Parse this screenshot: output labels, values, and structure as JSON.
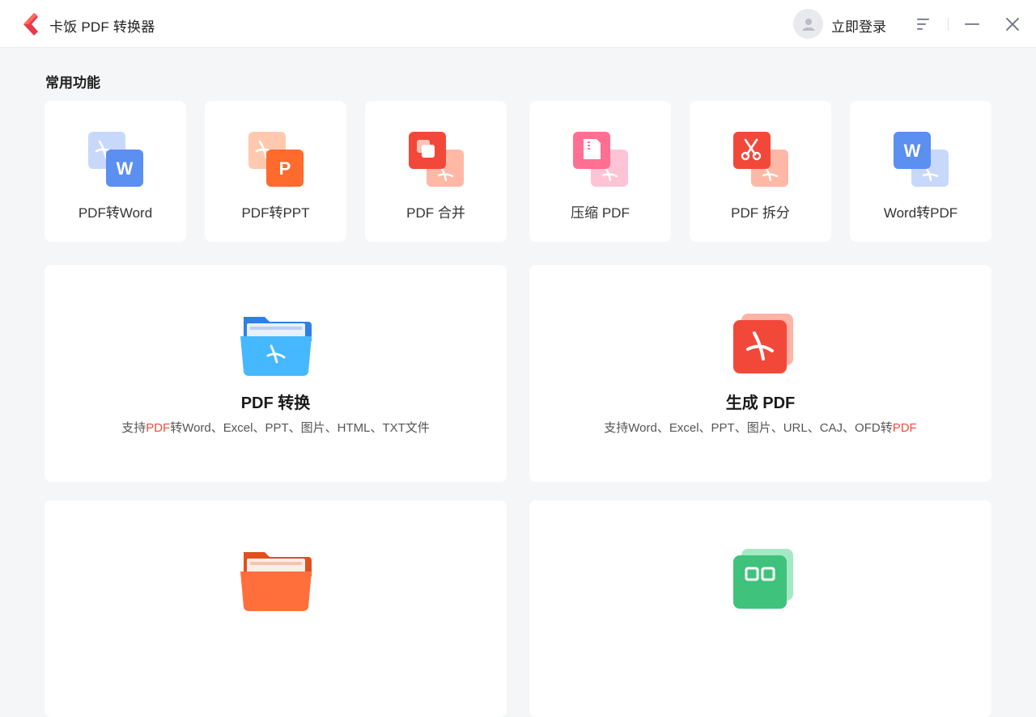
{
  "app": {
    "title": "卡饭 PDF 转换器",
    "login_label": "立即登录"
  },
  "section": {
    "common_title": "常用功能"
  },
  "tools": [
    {
      "label": "PDF转Word",
      "icon": "pdf-to-word-icon"
    },
    {
      "label": "PDF转PPT",
      "icon": "pdf-to-ppt-icon"
    },
    {
      "label": "PDF 合并",
      "icon": "pdf-merge-icon"
    },
    {
      "label": "压缩 PDF",
      "icon": "pdf-compress-icon"
    },
    {
      "label": "PDF 拆分",
      "icon": "pdf-split-icon"
    },
    {
      "label": "Word转PDF",
      "icon": "word-to-pdf-icon"
    }
  ],
  "features": [
    {
      "title": "PDF 转换",
      "desc_prefix": "支持",
      "desc_highlight": "PDF",
      "desc_suffix": "转Word、Excel、PPT、图片、HTML、TXT文件",
      "icon": "folder-pdf-icon"
    },
    {
      "title": "生成 PDF",
      "desc_prefix": "支持Word、Excel、PPT、图片、URL、CAJ、OFD转",
      "desc_highlight": "PDF",
      "desc_suffix": "",
      "icon": "create-pdf-icon"
    }
  ],
  "colors": {
    "accent_red": "#ef4b3c",
    "word_blue": "#5b8ff0",
    "ppt_orange": "#ff6a2d",
    "folder_blue": "#45b8ff",
    "folder_orange": "#ff6f3c",
    "green": "#3fc27b",
    "pink": "#ff6f91"
  }
}
